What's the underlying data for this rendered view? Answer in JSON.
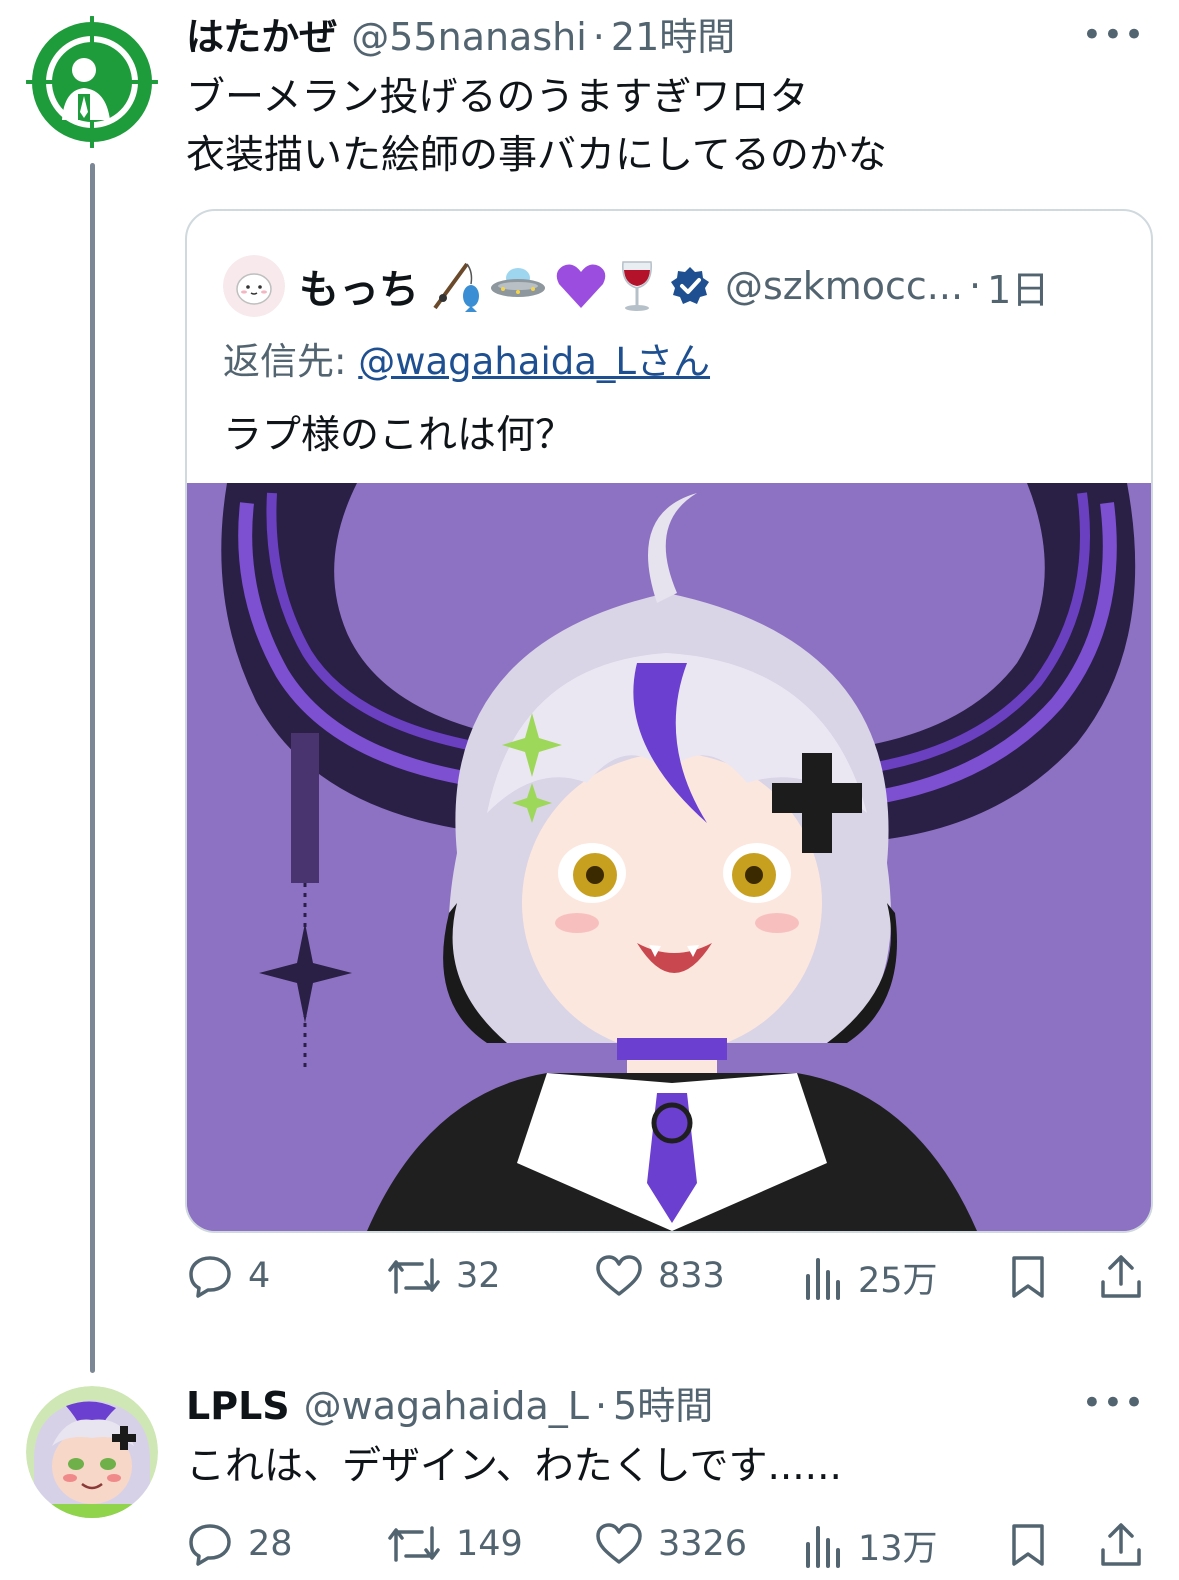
{
  "tweet1": {
    "name": "はたかぜ",
    "handle": "@55nanashi",
    "separator": "·",
    "time": "21時間",
    "more": "•••",
    "lines": [
      "ブーメラン投げるのうますぎワロタ",
      "衣装描いた絵師の事バカにしてるのかな"
    ],
    "quote": {
      "name": "もっち",
      "emojis": [
        "fishing-pole-icon",
        "ufo-icon",
        "purple-heart-icon",
        "wine-glass-icon"
      ],
      "handle": "@szkmocc...",
      "separator": "·",
      "time": "1日",
      "reply_prefix": "返信先: ",
      "reply_to": "@wagahaida_Lさん",
      "text": "ラプ様のこれは何？"
    },
    "stats": {
      "replies": "4",
      "reposts": "32",
      "likes": "833",
      "views": "25万"
    }
  },
  "tweet2": {
    "name": "LPLS",
    "handle": "@wagahaida_L",
    "separator": "·",
    "time": "5時間",
    "more": "•••",
    "text": "これは、デザイン、わたくしです......",
    "stats": {
      "replies": "28",
      "reposts": "149",
      "likes": "3326",
      "views": "13万"
    }
  },
  "colors": {
    "secondary_text": "#536471",
    "link": "#1d4f91",
    "verified": "#1d4f91",
    "thread_line": "#7b8794",
    "image_bg": "#8d72c3"
  }
}
